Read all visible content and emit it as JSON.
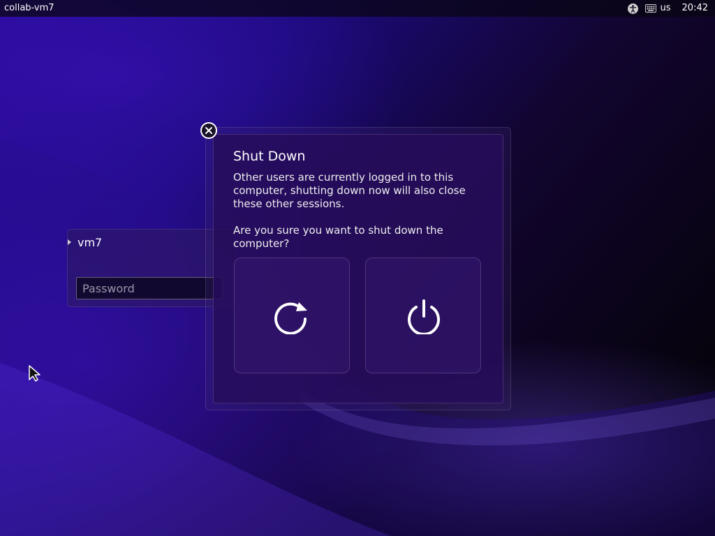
{
  "topbar": {
    "hostname": "collab-vm7",
    "keyboard_layout": "us",
    "clock": "20:42",
    "icons": [
      "accessibility-icon",
      "keyboard-icon"
    ]
  },
  "login": {
    "username": "vm7",
    "password_placeholder": "Password",
    "password_value": ""
  },
  "dialog": {
    "title": "Shut Down",
    "message": "Other users are currently logged in to this computer, shutting down now will also close these other sessions.",
    "question": "Are you sure you want to shut down the computer?",
    "buttons": [
      {
        "icon": "restart-icon"
      },
      {
        "icon": "power-icon"
      }
    ],
    "close_icon": "close-icon"
  },
  "colors": {
    "background_accent": "#2a0a9a",
    "dialog_bg": "#260c5a",
    "text": "#ffffff"
  }
}
